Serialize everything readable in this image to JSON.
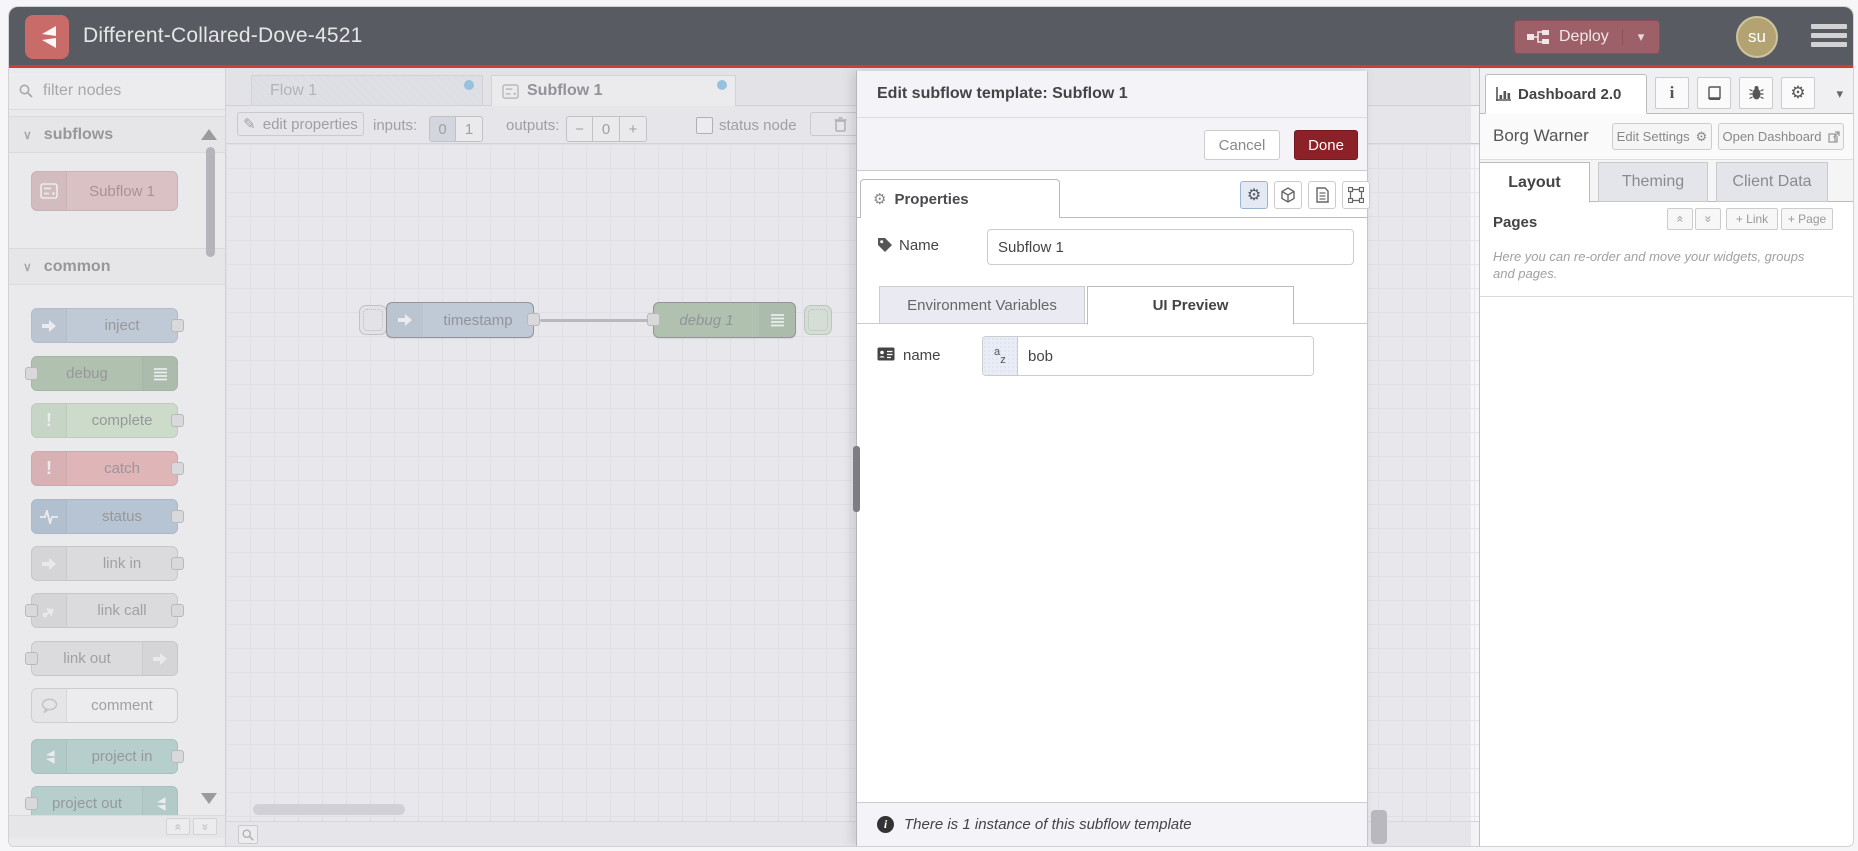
{
  "colors": {
    "header_bg": "#585c62",
    "header_accent": "#d23b2f",
    "logo_bg": "#c96b68",
    "deploy_bg": "#9d5f68",
    "avatar_bg": "#b3a372",
    "done_bg": "#8c2127",
    "tab_dot": "#55a9d8",
    "node_subflow": "#d8a8a8",
    "node_inject": "#a6bbcf",
    "node_debug": "#87a980",
    "node_complete": "#c0ddb6",
    "node_catch": "#e49191",
    "node_status": "#93afc7",
    "node_link": "#dddddd",
    "node_comment": "#ffffff",
    "node_project": "#93c5bb"
  },
  "header": {
    "title": "Different-Collared-Dove-4521",
    "deploy_label": "Deploy",
    "avatar": "su"
  },
  "palette": {
    "filter_placeholder": "filter nodes",
    "categories": [
      {
        "label": "subflows",
        "nodes": [
          {
            "label": "Subflow 1"
          }
        ]
      },
      {
        "label": "common",
        "nodes": [
          {
            "label": "inject"
          },
          {
            "label": "debug"
          },
          {
            "label": "complete"
          },
          {
            "label": "catch"
          },
          {
            "label": "status"
          },
          {
            "label": "link in"
          },
          {
            "label": "link call"
          },
          {
            "label": "link out"
          },
          {
            "label": "comment"
          },
          {
            "label": "project in"
          },
          {
            "label": "project out"
          }
        ]
      }
    ]
  },
  "workspace": {
    "tabs": [
      {
        "label": "Flow 1"
      },
      {
        "label": "Subflow 1"
      }
    ],
    "toolbar": {
      "edit_properties": "edit properties",
      "inputs_label": "inputs:",
      "input_options": [
        "0",
        "1"
      ],
      "inputs_selected": "0",
      "outputs_label": "outputs:",
      "outputs_minus": "−",
      "outputs_value": "0",
      "outputs_plus": "+",
      "status_node": "status node"
    },
    "nodes": [
      {
        "label": "timestamp"
      },
      {
        "label": "debug 1"
      }
    ]
  },
  "tray": {
    "title": "Edit subflow template: Subflow 1",
    "cancel": "Cancel",
    "done": "Done",
    "properties_tab": "Properties",
    "name_label": "Name",
    "name_value": "Subflow 1",
    "subtab_env": "Environment Variables",
    "subtab_ui": "UI Preview",
    "field_label": "name",
    "field_value": "bob",
    "footer_note": "There is 1 instance of this subflow template"
  },
  "sidebar": {
    "dashboard_tab": "Dashboard 2.0",
    "instance_name": "Borg Warner",
    "edit_settings": "Edit Settings",
    "open_dashboard": "Open Dashboard",
    "tabs": [
      "Layout",
      "Theming",
      "Client Data"
    ],
    "pages_title": "Pages",
    "add_link": "+ Link",
    "add_page": "+ Page",
    "help_text": "Here you can re-order and move your widgets, groups and pages."
  }
}
